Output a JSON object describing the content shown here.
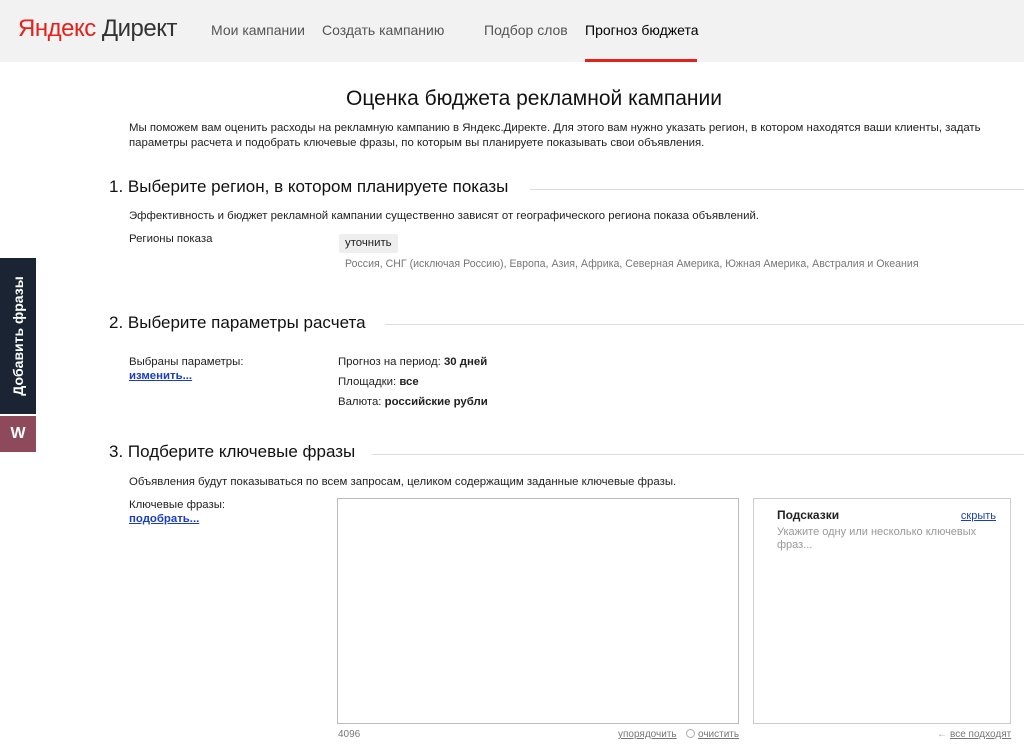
{
  "header": {
    "logo_part1": "Яндекс",
    "logo_part2": "Директ",
    "nav": [
      "Мои кампании",
      "Создать кампанию",
      "Подбор слов",
      "Прогноз бюджета"
    ]
  },
  "side": {
    "add_phrases": "Добавить фразы",
    "w_label": "W"
  },
  "page": {
    "title": "Оценка бюджета рекламной кампании",
    "intro": "Мы поможем вам оценить расходы на рекламную кампанию в Яндекс.Директе. Для этого вам нужно указать регион, в котором находятся ваши клиенты, задать параметры расчета и подобрать ключевые фразы, по которым вы планируете показывать свои объявления."
  },
  "section1": {
    "heading": "1. Выберите регион, в котором планируете показы",
    "desc": "Эффективность и бюджет рекламной кампании существенно зависят от географического региона показа объявлений.",
    "regions_label": "Регионы показа",
    "refine_button": "уточнить",
    "regions_value": "Россия, СНГ (исключая Россию), Европа, Азия, Африка, Северная Америка, Южная Америка, Австралия и Океания"
  },
  "section2": {
    "heading": "2. Выберите параметры расчета",
    "selected_label": "Выбраны параметры:",
    "change_link": "изменить...",
    "period_label": "Прогноз на период:",
    "period_value": "30 дней",
    "sites_label": "Площадки:",
    "sites_value": "все",
    "currency_label": "Валюта:",
    "currency_value": "российские рубли"
  },
  "section3": {
    "heading": "3. Подберите ключевые фразы",
    "desc": "Объявления будут показываться по всем запросам, целиком содержащим заданные ключевые фразы.",
    "keywords_label": "Ключевые фразы:",
    "pick_link": "подобрать...",
    "char_limit": "4096",
    "sort_link": "упорядочить",
    "clear_link": "очистить",
    "hints_title": "Подсказки",
    "hints_hide": "скрыть",
    "hints_text": "Укажите одну или несколько ключевых фраз...",
    "all_fit": "все подходят"
  }
}
